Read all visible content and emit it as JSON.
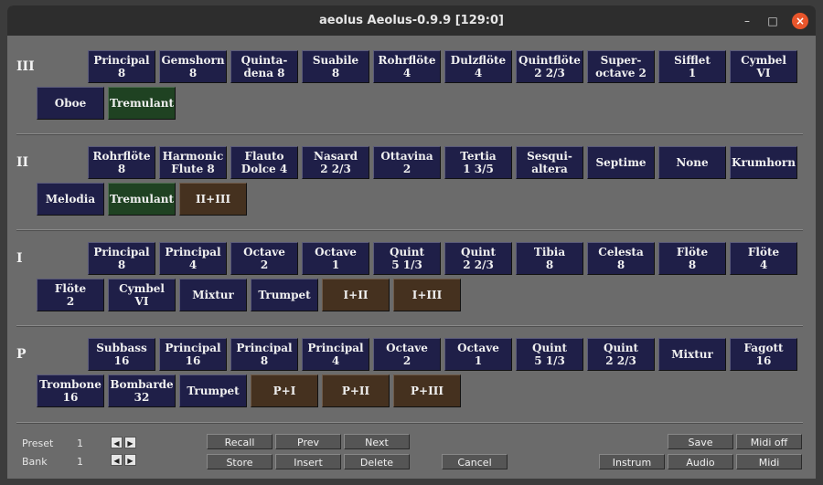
{
  "titlebar": {
    "title": "aeolus  Aeolus-0.9.9  [129:0]",
    "min": "–",
    "max": "□",
    "close": "×"
  },
  "divisions": [
    {
      "label": "III",
      "stops": [
        {
          "label": "Principal\n8",
          "type": "stop"
        },
        {
          "label": "Gemshorn\n8",
          "type": "stop"
        },
        {
          "label": "Quinta-\ndena 8",
          "type": "stop"
        },
        {
          "label": "Suabile\n8",
          "type": "stop"
        },
        {
          "label": "Rohrflöte\n4",
          "type": "stop"
        },
        {
          "label": "Dulzflöte\n4",
          "type": "stop"
        },
        {
          "label": "Quintflöte\n2 2/3",
          "type": "stop"
        },
        {
          "label": "Super-\noctave 2",
          "type": "stop"
        },
        {
          "label": "Sifflet\n1",
          "type": "stop"
        },
        {
          "label": "Cymbel\nVI",
          "type": "stop"
        },
        {
          "label": "Oboe",
          "type": "stop"
        },
        {
          "label": "Tremulant",
          "type": "trem"
        }
      ]
    },
    {
      "label": "II",
      "stops": [
        {
          "label": "Rohrflöte\n8",
          "type": "stop"
        },
        {
          "label": "Harmonic\nFlute 8",
          "type": "stop"
        },
        {
          "label": "Flauto\nDolce 4",
          "type": "stop"
        },
        {
          "label": "Nasard\n2 2/3",
          "type": "stop"
        },
        {
          "label": "Ottavina\n2",
          "type": "stop"
        },
        {
          "label": "Tertia\n1 3/5",
          "type": "stop"
        },
        {
          "label": "Sesqui-\naltera",
          "type": "stop"
        },
        {
          "label": "Septime",
          "type": "stop"
        },
        {
          "label": "None",
          "type": "stop"
        },
        {
          "label": "Krumhorn",
          "type": "stop"
        },
        {
          "label": "Melodia",
          "type": "stop"
        },
        {
          "label": "Tremulant",
          "type": "trem"
        },
        {
          "label": "II+III",
          "type": "coup"
        }
      ]
    },
    {
      "label": "I",
      "stops": [
        {
          "label": "Principal\n8",
          "type": "stop"
        },
        {
          "label": "Principal\n4",
          "type": "stop"
        },
        {
          "label": "Octave\n2",
          "type": "stop"
        },
        {
          "label": "Octave\n1",
          "type": "stop"
        },
        {
          "label": "Quint\n5 1/3",
          "type": "stop"
        },
        {
          "label": "Quint\n2 2/3",
          "type": "stop"
        },
        {
          "label": "Tibia\n8",
          "type": "stop"
        },
        {
          "label": "Celesta\n8",
          "type": "stop"
        },
        {
          "label": "Flöte\n8",
          "type": "stop"
        },
        {
          "label": "Flöte\n4",
          "type": "stop"
        },
        {
          "label": "Flöte\n2",
          "type": "stop"
        },
        {
          "label": "Cymbel\nVI",
          "type": "stop"
        },
        {
          "label": "Mixtur",
          "type": "stop"
        },
        {
          "label": "Trumpet",
          "type": "stop"
        },
        {
          "label": "I+II",
          "type": "coup"
        },
        {
          "label": "I+III",
          "type": "coup"
        }
      ]
    },
    {
      "label": "P",
      "stops": [
        {
          "label": "Subbass\n16",
          "type": "stop"
        },
        {
          "label": "Principal\n16",
          "type": "stop"
        },
        {
          "label": "Principal\n8",
          "type": "stop"
        },
        {
          "label": "Principal\n4",
          "type": "stop"
        },
        {
          "label": "Octave\n2",
          "type": "stop"
        },
        {
          "label": "Octave\n1",
          "type": "stop"
        },
        {
          "label": "Quint\n5 1/3",
          "type": "stop"
        },
        {
          "label": "Quint\n2 2/3",
          "type": "stop"
        },
        {
          "label": "Mixtur",
          "type": "stop"
        },
        {
          "label": "Fagott\n16",
          "type": "stop"
        },
        {
          "label": "Trombone\n16",
          "type": "stop"
        },
        {
          "label": "Bombarde\n32",
          "type": "stop"
        },
        {
          "label": "Trumpet",
          "type": "stop"
        },
        {
          "label": "P+I",
          "type": "coup"
        },
        {
          "label": "P+II",
          "type": "coup"
        },
        {
          "label": "P+III",
          "type": "coup"
        }
      ]
    }
  ],
  "controls": {
    "preset_label": "Preset",
    "preset_value": "1",
    "bank_label": "Bank",
    "bank_value": "1",
    "arrow_left": "◀",
    "arrow_right": "▶",
    "recall": "Recall",
    "prev": "Prev",
    "next": "Next",
    "store": "Store",
    "insert": "Insert",
    "delete": "Delete",
    "cancel": "Cancel",
    "save": "Save",
    "midi_off": "Midi off",
    "instrum": "Instrum",
    "audio": "Audio",
    "midi": "Midi"
  }
}
